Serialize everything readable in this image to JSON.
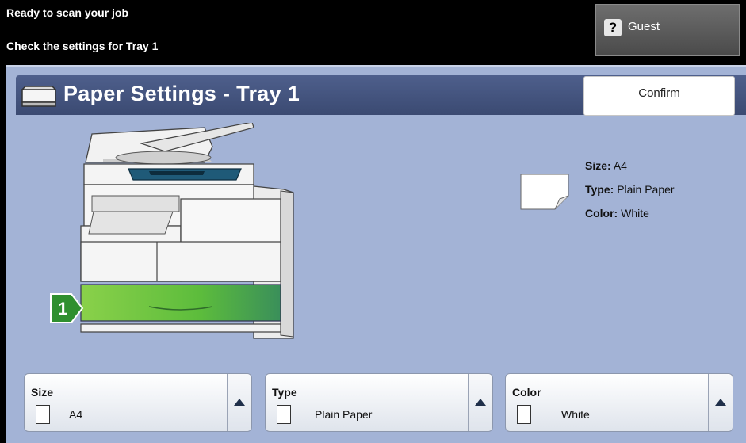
{
  "status": {
    "line1": "Ready to scan your job",
    "line2": "Check the settings for Tray 1"
  },
  "user": {
    "label": "Guest"
  },
  "header": {
    "title": "Paper Settings - Tray 1",
    "confirm_label": "Confirm"
  },
  "tray_badge": "1",
  "summary": {
    "size_label": "Size:",
    "size_value": "A4",
    "type_label": "Type:",
    "type_value": "Plain Paper",
    "color_label": "Color:",
    "color_value": "White"
  },
  "settings": {
    "size": {
      "label": "Size",
      "value": "A4"
    },
    "type": {
      "label": "Type",
      "value": "Plain Paper"
    },
    "color": {
      "label": "Color",
      "value": "White"
    }
  },
  "colors": {
    "panel": "#a3b3d6",
    "titlebar": "#4e5f8c",
    "tray_highlight": "#5fbd3c"
  }
}
